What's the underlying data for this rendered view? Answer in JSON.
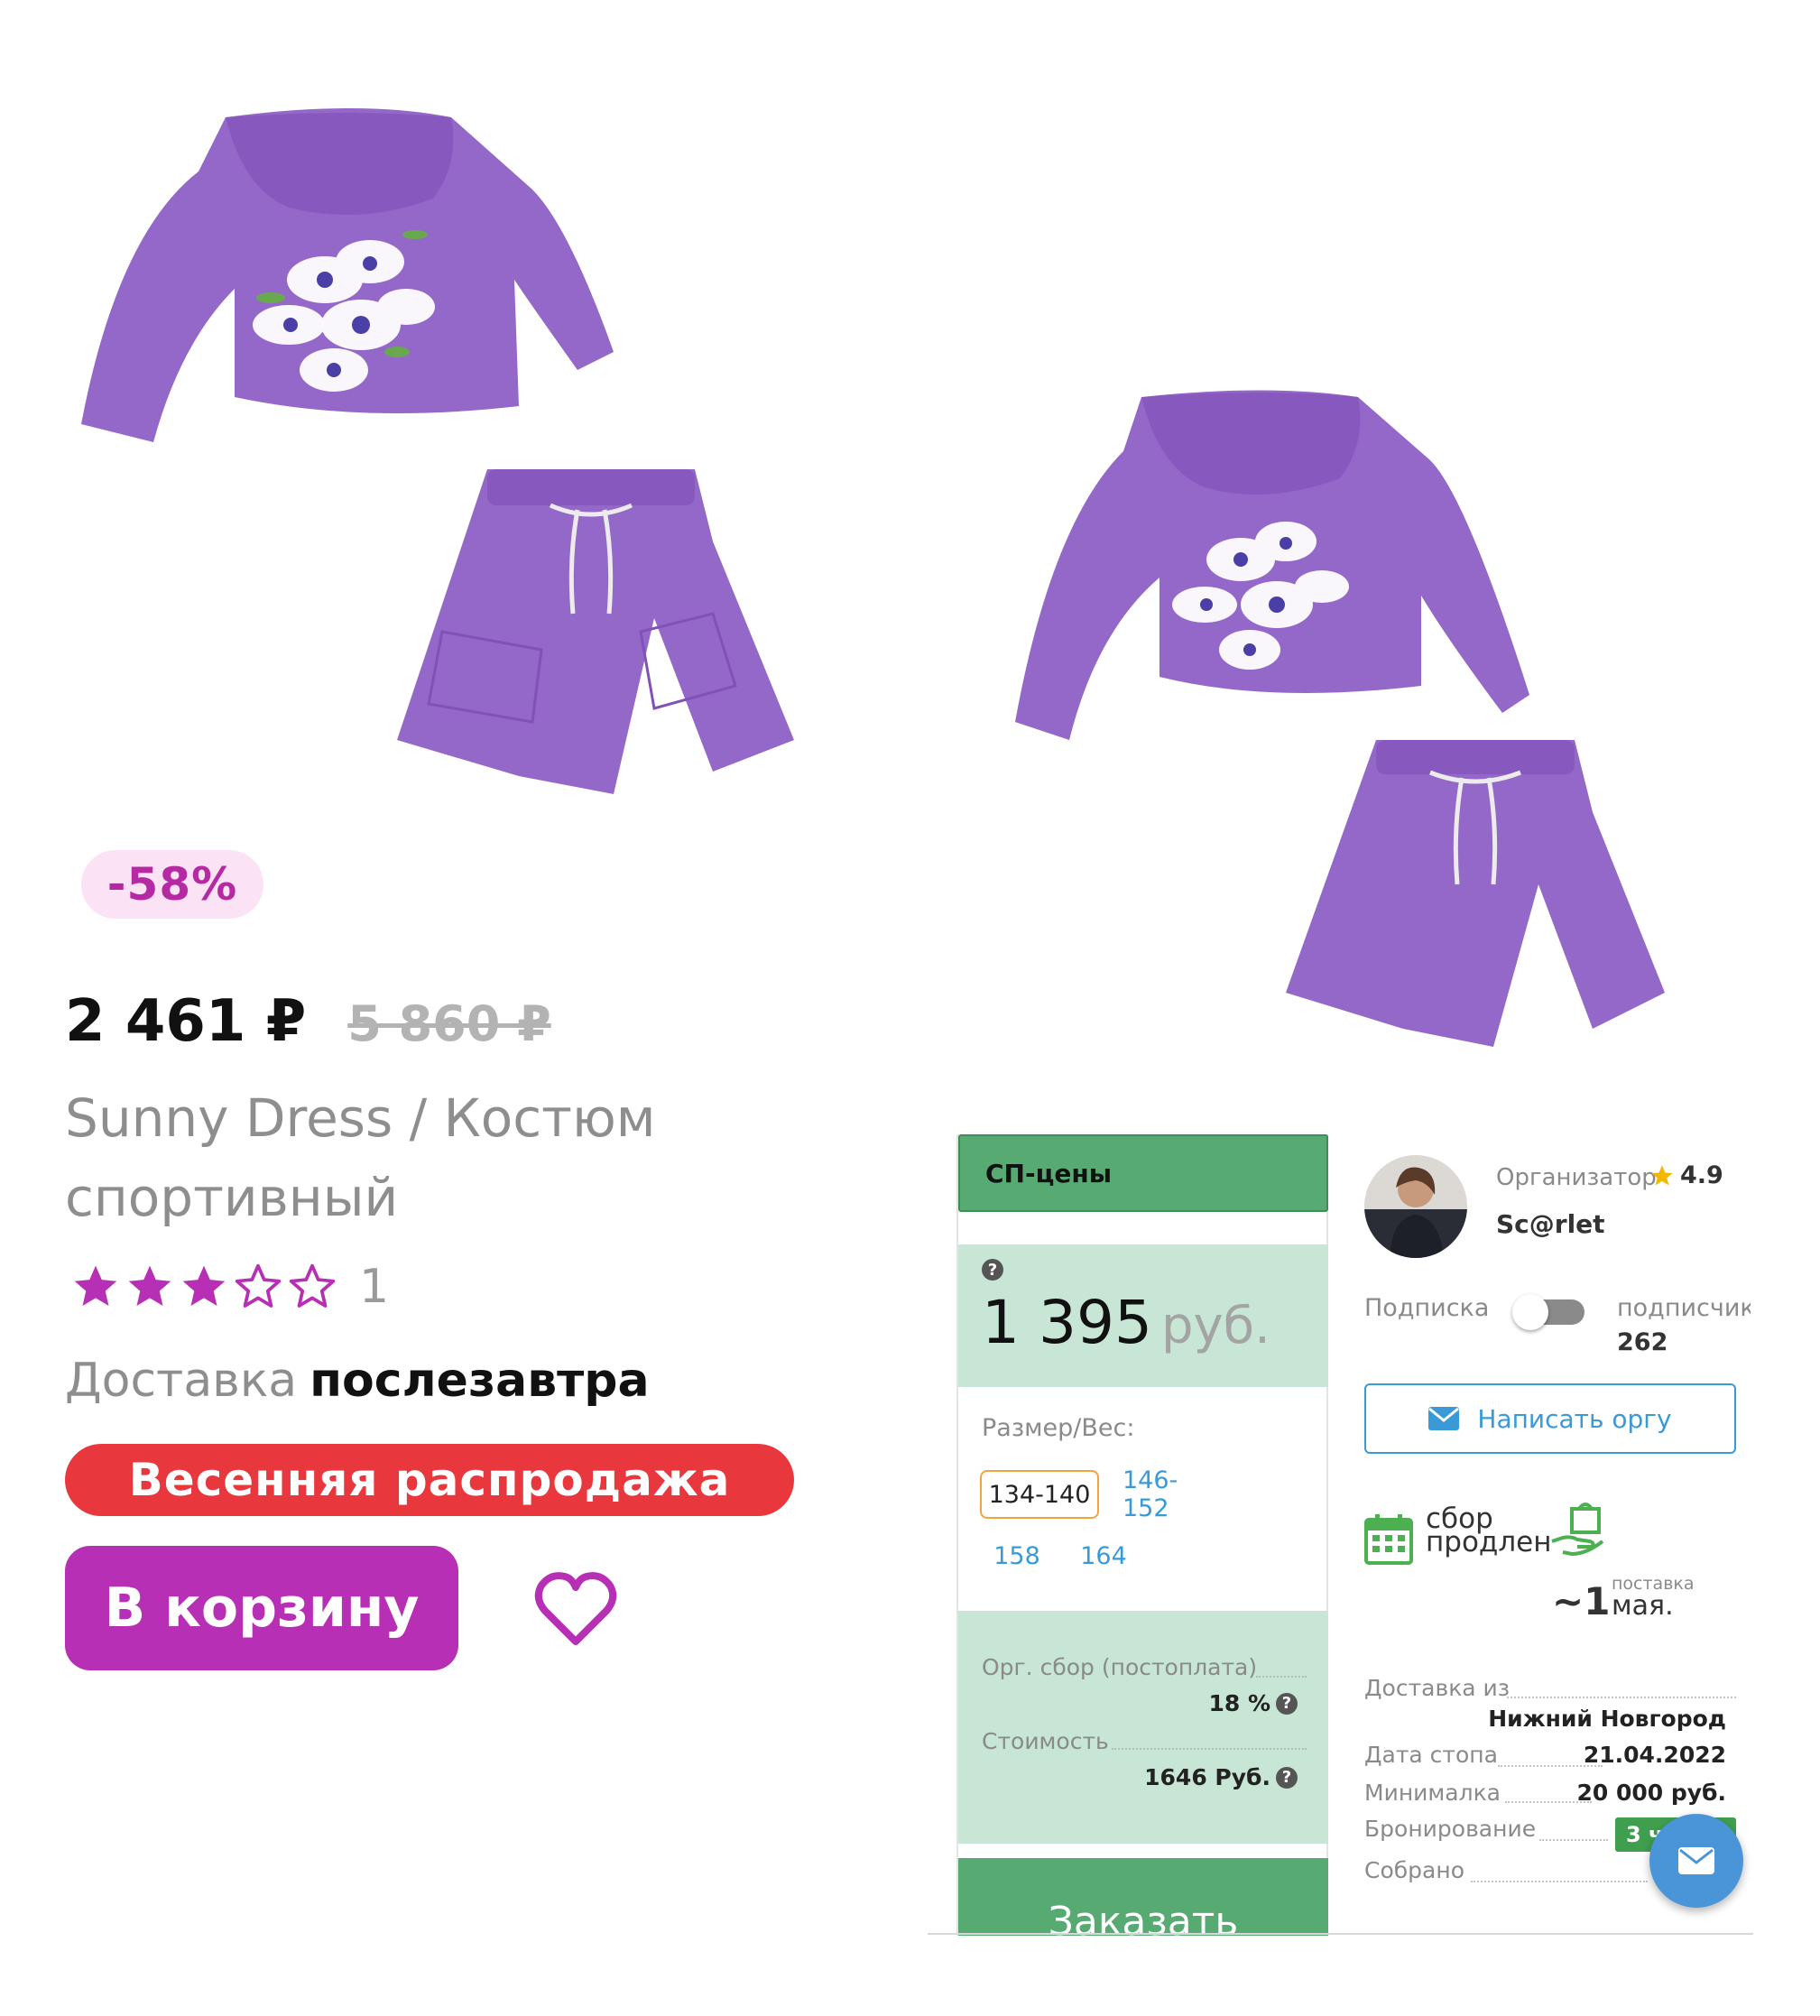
{
  "left": {
    "discount": "-58%",
    "price_now": "2 461 ₽",
    "price_old": "5 860 ₽",
    "title_line1": "Sunny Dress / Костюм",
    "title_line2": "спортивный",
    "rating": 3,
    "rating_max": 5,
    "review_count": "1",
    "delivery_label": "Доставка",
    "delivery_value": "послезавтра",
    "sale_banner": "Весенняя распродажа",
    "cart_button": "В корзину",
    "colors": {
      "accent": "#b72fb5",
      "sale": "#e8383d",
      "badge_bg": "#fbe3f5"
    },
    "icons": {
      "favorite": "heart-outline-icon",
      "star": "star-icon"
    }
  },
  "right": {
    "sp_header": "СП-цены",
    "sp_price": "1 395",
    "sp_price_unit": "руб.",
    "size_label": "Размер/Вес:",
    "sizes": [
      "134-140",
      "146-152",
      "158",
      "164"
    ],
    "selected_size": "134-140",
    "fee_label": "Орг. сбор (постоплата)",
    "fee_value": "18 %",
    "cost_label": "Стоимость",
    "cost_value": "1646 Руб.",
    "order_button": "Заказать",
    "organizer_label": "Организатор",
    "organizer_rating": "4.9",
    "organizer_name": "Sc@rlet",
    "subscription_label": "Подписка",
    "subscribers_label": "подписчиков",
    "subscribers_count": "262",
    "write_button": "Написать оргу",
    "collection_line1": "сбор",
    "collection_line2": "продлен",
    "delivery_approx": "~1",
    "delivery_small": "поставка",
    "delivery_month": "мая.",
    "info": {
      "delivery_from_label": "Доставка из",
      "delivery_from_value": "Нижний Новгород",
      "stop_date_label": "Дата стопа",
      "stop_date_value": "21.04.2022",
      "minimum_label": "Минималка",
      "minimum_value": "20 000 руб.",
      "booking_label": "Бронирование",
      "booking_value": "3 ч",
      "collected_label": "Собрано"
    },
    "colors": {
      "green": "#57ab72",
      "mint": "#c7e6d5",
      "link": "#3a9ad8",
      "star": "#f4b800"
    },
    "icons": {
      "help": "question-circle-icon",
      "mail": "envelope-icon",
      "calendar": "calendar-icon",
      "delivery": "hand-package-icon",
      "fab": "envelope-fab-icon"
    }
  }
}
